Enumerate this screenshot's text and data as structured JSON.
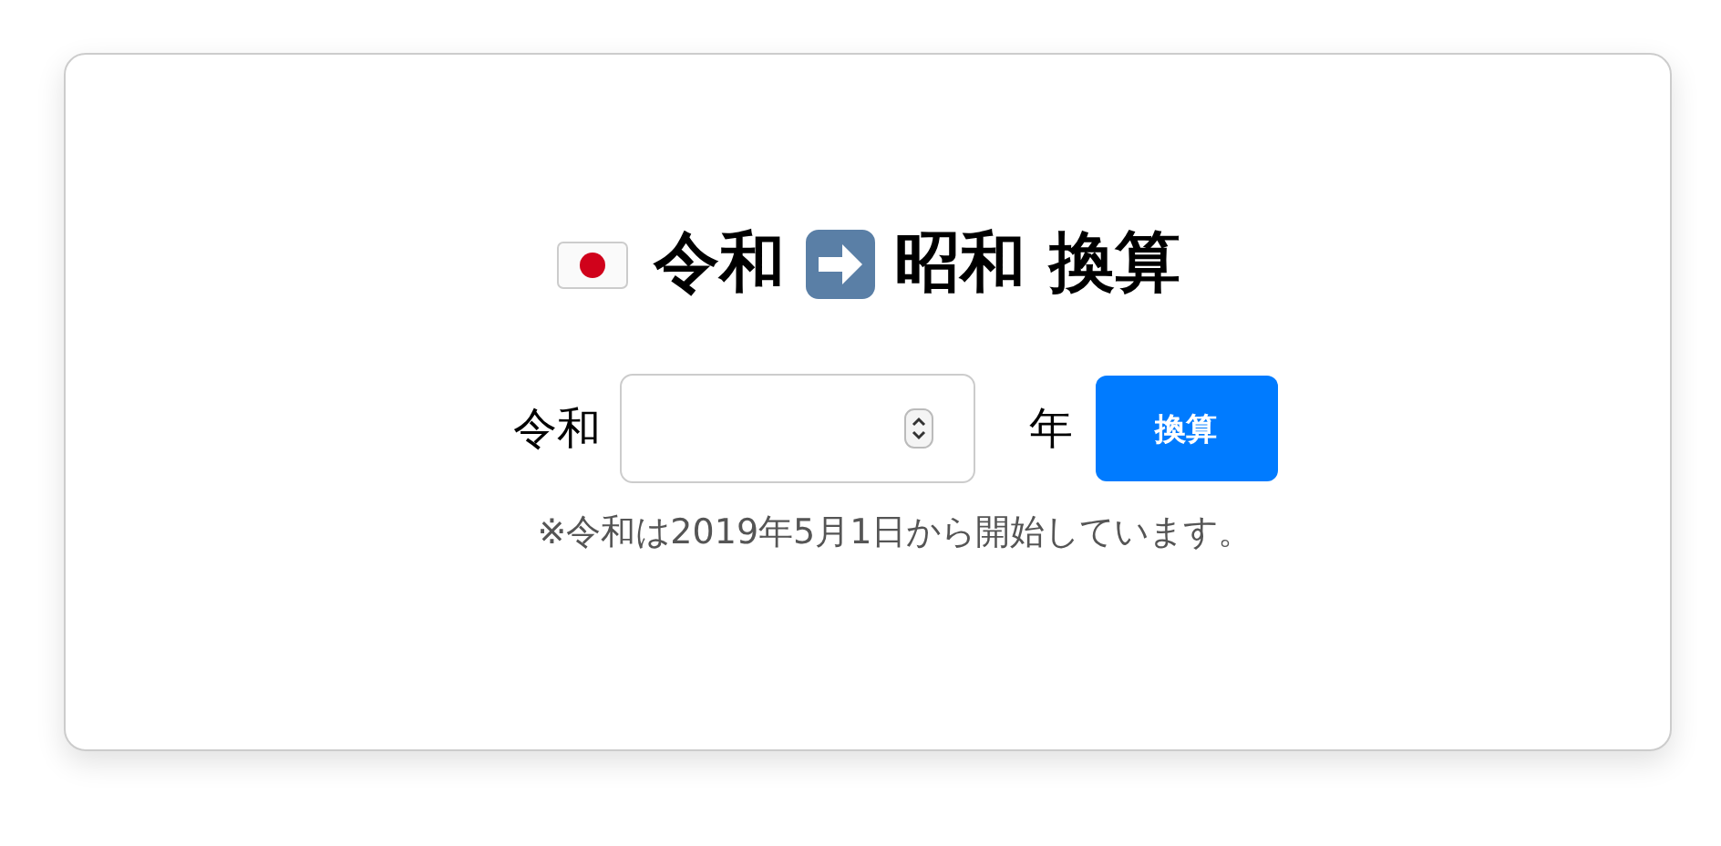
{
  "title": {
    "from": "令和",
    "to": "昭和 換算"
  },
  "form": {
    "prefix": "令和",
    "suffix": "年",
    "button": "換算"
  },
  "note": "※令和は2019年5月1日から開始しています。"
}
